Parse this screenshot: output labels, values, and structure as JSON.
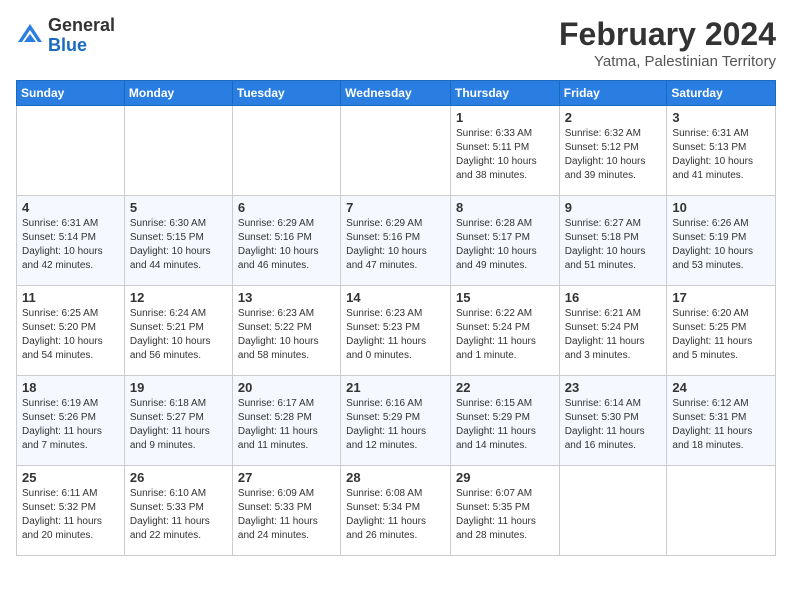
{
  "logo": {
    "general": "General",
    "blue": "Blue"
  },
  "header": {
    "month": "February 2024",
    "location": "Yatma, Palestinian Territory"
  },
  "weekdays": [
    "Sunday",
    "Monday",
    "Tuesday",
    "Wednesday",
    "Thursday",
    "Friday",
    "Saturday"
  ],
  "weeks": [
    [
      {
        "day": "",
        "info": ""
      },
      {
        "day": "",
        "info": ""
      },
      {
        "day": "",
        "info": ""
      },
      {
        "day": "",
        "info": ""
      },
      {
        "day": "1",
        "info": "Sunrise: 6:33 AM\nSunset: 5:11 PM\nDaylight: 10 hours and 38 minutes."
      },
      {
        "day": "2",
        "info": "Sunrise: 6:32 AM\nSunset: 5:12 PM\nDaylight: 10 hours and 39 minutes."
      },
      {
        "day": "3",
        "info": "Sunrise: 6:31 AM\nSunset: 5:13 PM\nDaylight: 10 hours and 41 minutes."
      }
    ],
    [
      {
        "day": "4",
        "info": "Sunrise: 6:31 AM\nSunset: 5:14 PM\nDaylight: 10 hours and 42 minutes."
      },
      {
        "day": "5",
        "info": "Sunrise: 6:30 AM\nSunset: 5:15 PM\nDaylight: 10 hours and 44 minutes."
      },
      {
        "day": "6",
        "info": "Sunrise: 6:29 AM\nSunset: 5:16 PM\nDaylight: 10 hours and 46 minutes."
      },
      {
        "day": "7",
        "info": "Sunrise: 6:29 AM\nSunset: 5:16 PM\nDaylight: 10 hours and 47 minutes."
      },
      {
        "day": "8",
        "info": "Sunrise: 6:28 AM\nSunset: 5:17 PM\nDaylight: 10 hours and 49 minutes."
      },
      {
        "day": "9",
        "info": "Sunrise: 6:27 AM\nSunset: 5:18 PM\nDaylight: 10 hours and 51 minutes."
      },
      {
        "day": "10",
        "info": "Sunrise: 6:26 AM\nSunset: 5:19 PM\nDaylight: 10 hours and 53 minutes."
      }
    ],
    [
      {
        "day": "11",
        "info": "Sunrise: 6:25 AM\nSunset: 5:20 PM\nDaylight: 10 hours and 54 minutes."
      },
      {
        "day": "12",
        "info": "Sunrise: 6:24 AM\nSunset: 5:21 PM\nDaylight: 10 hours and 56 minutes."
      },
      {
        "day": "13",
        "info": "Sunrise: 6:23 AM\nSunset: 5:22 PM\nDaylight: 10 hours and 58 minutes."
      },
      {
        "day": "14",
        "info": "Sunrise: 6:23 AM\nSunset: 5:23 PM\nDaylight: 11 hours and 0 minutes."
      },
      {
        "day": "15",
        "info": "Sunrise: 6:22 AM\nSunset: 5:24 PM\nDaylight: 11 hours and 1 minute."
      },
      {
        "day": "16",
        "info": "Sunrise: 6:21 AM\nSunset: 5:24 PM\nDaylight: 11 hours and 3 minutes."
      },
      {
        "day": "17",
        "info": "Sunrise: 6:20 AM\nSunset: 5:25 PM\nDaylight: 11 hours and 5 minutes."
      }
    ],
    [
      {
        "day": "18",
        "info": "Sunrise: 6:19 AM\nSunset: 5:26 PM\nDaylight: 11 hours and 7 minutes."
      },
      {
        "day": "19",
        "info": "Sunrise: 6:18 AM\nSunset: 5:27 PM\nDaylight: 11 hours and 9 minutes."
      },
      {
        "day": "20",
        "info": "Sunrise: 6:17 AM\nSunset: 5:28 PM\nDaylight: 11 hours and 11 minutes."
      },
      {
        "day": "21",
        "info": "Sunrise: 6:16 AM\nSunset: 5:29 PM\nDaylight: 11 hours and 12 minutes."
      },
      {
        "day": "22",
        "info": "Sunrise: 6:15 AM\nSunset: 5:29 PM\nDaylight: 11 hours and 14 minutes."
      },
      {
        "day": "23",
        "info": "Sunrise: 6:14 AM\nSunset: 5:30 PM\nDaylight: 11 hours and 16 minutes."
      },
      {
        "day": "24",
        "info": "Sunrise: 6:12 AM\nSunset: 5:31 PM\nDaylight: 11 hours and 18 minutes."
      }
    ],
    [
      {
        "day": "25",
        "info": "Sunrise: 6:11 AM\nSunset: 5:32 PM\nDaylight: 11 hours and 20 minutes."
      },
      {
        "day": "26",
        "info": "Sunrise: 6:10 AM\nSunset: 5:33 PM\nDaylight: 11 hours and 22 minutes."
      },
      {
        "day": "27",
        "info": "Sunrise: 6:09 AM\nSunset: 5:33 PM\nDaylight: 11 hours and 24 minutes."
      },
      {
        "day": "28",
        "info": "Sunrise: 6:08 AM\nSunset: 5:34 PM\nDaylight: 11 hours and 26 minutes."
      },
      {
        "day": "29",
        "info": "Sunrise: 6:07 AM\nSunset: 5:35 PM\nDaylight: 11 hours and 28 minutes."
      },
      {
        "day": "",
        "info": ""
      },
      {
        "day": "",
        "info": ""
      }
    ]
  ]
}
